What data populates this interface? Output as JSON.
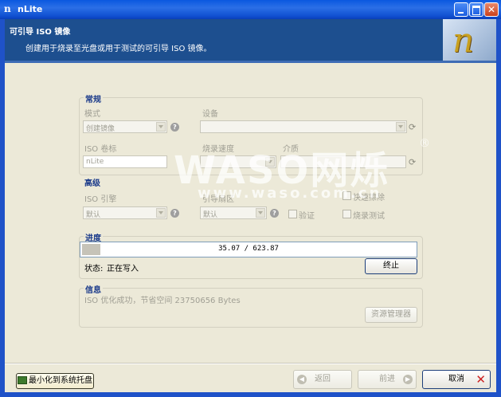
{
  "window": {
    "title": "nLite",
    "app_icon": "n"
  },
  "header": {
    "title": "可引导 ISO 镜像",
    "subtitle": "创建用于烧录至光盘或用于测试的可引导 ISO 镜像。"
  },
  "general": {
    "title": "常规",
    "mode_label": "模式",
    "mode_value": "创建镜像",
    "device_label": "设备",
    "device_value": "",
    "iso_label_label": "ISO 卷标",
    "iso_label_value": "nLite",
    "burn_speed_label": "烧录速度",
    "burn_speed_value": "",
    "media_label": "介质",
    "media_value": ""
  },
  "advanced": {
    "title": "高级",
    "iso_engine_label": "ISO 引擎",
    "iso_engine_value": "默认",
    "boot_sector_label": "引导扇区",
    "boot_sector_value": "默认",
    "quick_erase_label": "快速擦除",
    "verify_label": "验证",
    "burn_test_label": "烧录测试"
  },
  "progress": {
    "title": "进度",
    "text": "35.07 / 623.87",
    "done": 35.07,
    "total": 623.87,
    "status_label": "状态:",
    "status_value": "正在写入",
    "abort_button": "终止"
  },
  "info": {
    "title": "信息",
    "text": "ISO 优化成功，节省空间 23750656 Bytes",
    "explorer_button": "资源管理器"
  },
  "footer": {
    "minimize_tray": "最小化到系统托盘",
    "back": "返回",
    "next": "前进",
    "cancel": "取消"
  },
  "watermark": {
    "main": "WASO网烁",
    "reg": "®",
    "url": "www.waso.com.cn"
  },
  "colors": {
    "titlebar": "#0a58e0",
    "header_bg": "#1d4f8f",
    "group_title": "#1a3a8a",
    "window_bg": "#ece9d8",
    "cancel_x": "#cc2222"
  }
}
